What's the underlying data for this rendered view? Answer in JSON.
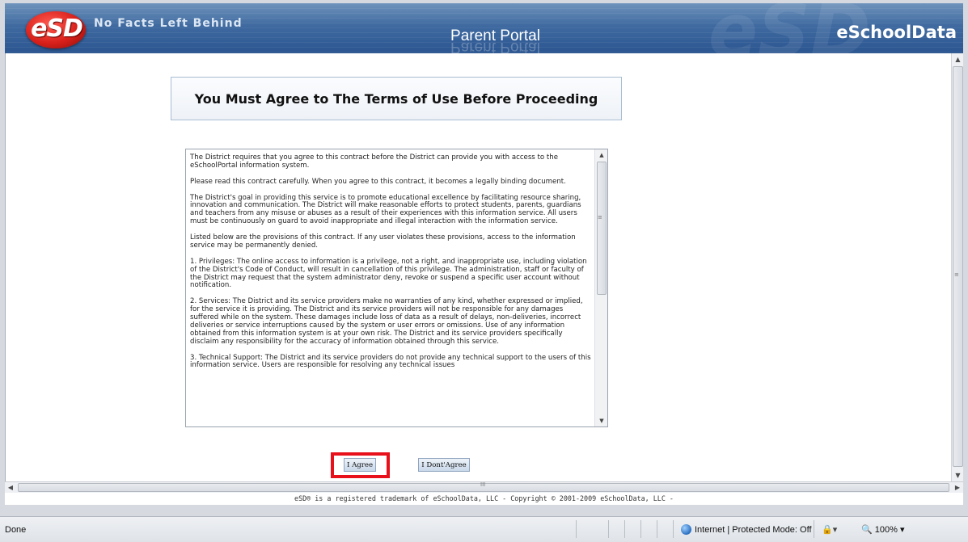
{
  "header": {
    "logo_text": "eSD",
    "tagline": "No Facts Left Behind",
    "portal_title": "Parent Portal",
    "brand": "eSchoolData"
  },
  "page": {
    "title": "You Must Agree to The Terms of Use Before Proceeding"
  },
  "terms": {
    "paragraphs": [
      "The District requires that you agree to this contract before the District can provide you with access to the eSchoolPortal information system.",
      "Please read this contract carefully. When you agree to this contract, it becomes a legally binding document.",
      "The District's goal in providing this service is to promote educational excellence by facilitating resource sharing, innovation and communication.  The District will make reasonable efforts to protect students, parents, guardians and teachers from any misuse or abuses as a result of their experiences with this information service.  All users must be continuously on guard to avoid inappropriate and illegal interaction with the information service.",
      "Listed below are the provisions of this contract.  If any user violates these provisions, access to the information service may be permanently denied.",
      "1. Privileges: The online access to information is a privilege, not a right, and inappropriate use, including violation of the District's Code of Conduct, will result in cancellation of this privilege.  The administration, staff or faculty of the District may request that the system administrator deny, revoke or suspend a specific user account without notification.",
      "2. Services: The District and its service providers make no warranties of any kind, whether expressed or implied, for the service it is providing.  The District and its service providers will not be responsible for any damages suffered while on the system. These damages include loss of data as a result of delays, non-deliveries, incorrect deliveries or service interruptions caused by the system or user errors or omissions.  Use of any information obtained from this information system is at your own risk.  The District and its service providers specifically disclaim any responsibility for the accuracy of information obtained through this service.",
      "3. Technical Support: The District and its service providers do not provide any technical support to the users of this information service.  Users are responsible for resolving any technical issues"
    ]
  },
  "buttons": {
    "agree": "I Agree",
    "disagree": "I Dont'Agree"
  },
  "footer": {
    "copyright": "eSD® is a registered trademark of eSchoolData, LLC - Copyright © 2001-2009 eSchoolData, LLC -"
  },
  "status_bar": {
    "status": "Done",
    "zone": "Internet | Protected Mode: Off",
    "zoom": "100%"
  },
  "colors": {
    "banner": "#3f6aa0",
    "highlight": "#e8101a"
  },
  "icons": [
    "globe-icon",
    "lock-icon",
    "zoom-icon"
  ]
}
